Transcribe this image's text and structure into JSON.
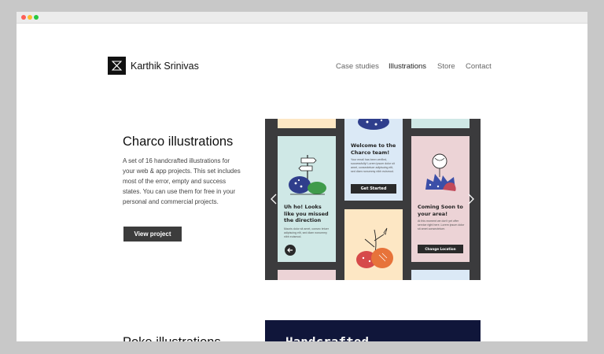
{
  "site": {
    "owner_name": "Karthik Srinivas",
    "nav": [
      "Case studies",
      "Illustrations",
      "Store",
      "Contact"
    ],
    "active_nav": "Illustrations"
  },
  "projects": [
    {
      "title": "Charco illustrations",
      "description": "A set of 16 handcrafted illustrations for your web & app projects. This set includes most of the error, empty and success states. You can use them for free in your personal and commercial projects.",
      "button_label": "View project",
      "showcase": {
        "card_lost": {
          "title": "Uh ho! Looks like you missed the direction",
          "body": "Mauris dolor sit amet, consec tetuer adipiscing elit, sed diam nonummy nibh euismod."
        },
        "card_welcome": {
          "title": "Welcome to the Charco team!",
          "body": "Your email has been verified, successfully! Lorem ipsum dolor sit amet, consectetuer adipiscing elit, sed diam nonummy nibh euismod.",
          "button": "Get Started"
        },
        "card_coming": {
          "title": "Coming Soon to your area!",
          "body": "At this moment we don't yet offer service right here. Lorem ipsum dolor sit amet consectetuer.",
          "button": "Change Location"
        }
      }
    },
    {
      "title": "Poke illustrations",
      "banner_text": "Handcrafted"
    }
  ],
  "colors": {
    "browser_bg": "#c8c8c8",
    "showcase_bg": "#3b3b3d",
    "card_mint": "#cfe8e6",
    "card_blue": "#dbe9f6",
    "card_pink": "#ecd3d6",
    "card_peach": "#fde7c4",
    "banner_navy": "#10163a"
  }
}
